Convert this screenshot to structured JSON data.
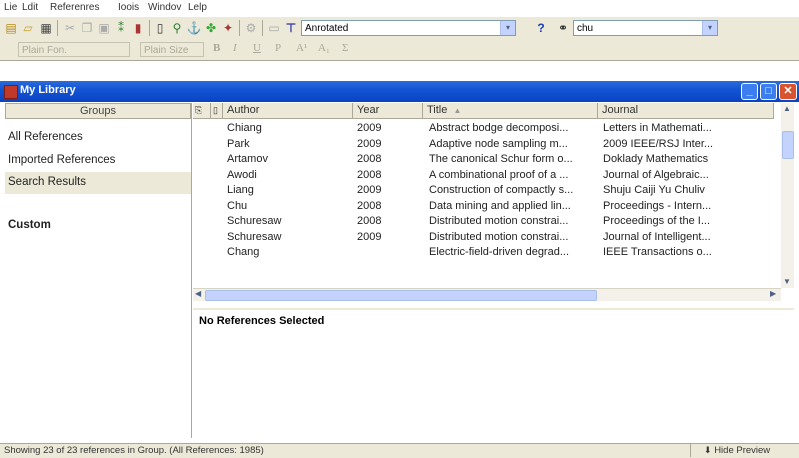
{
  "menu": [
    "Lie",
    "Ldit",
    "Referenres",
    "Ioois",
    "Windov",
    "Lelp"
  ],
  "toolbar": {
    "style_combo": "Anrotated",
    "help_label": "?",
    "search_combo": "chu"
  },
  "format_bar": {
    "font": "Plain Fon.",
    "size": "Plain Size",
    "bold": "B",
    "italic": "I",
    "underline": "U",
    "plain": "P",
    "superscript": "A¹",
    "subscript": "A₁",
    "symbol": "Σ"
  },
  "window": {
    "title": "My Library"
  },
  "groups": {
    "header": "Groups",
    "items": [
      "All References",
      "Imported References",
      "Search Results"
    ],
    "custom_label": "Custom"
  },
  "table": {
    "columns": [
      "Author",
      "Year",
      "Title",
      "Journal"
    ],
    "rows": [
      {
        "author": "Chiang",
        "year": "2009",
        "title": "Abstract bodge decomposi...",
        "journal": "Letters in Mathemati..."
      },
      {
        "author": "Park",
        "year": "2009",
        "title": "Adaptive node sampling m...",
        "journal": "2009 IEEE/RSJ Inter..."
      },
      {
        "author": "Artamov",
        "year": "2008",
        "title": "The canonical Schur form o...",
        "journal": "Doklady Mathematics"
      },
      {
        "author": "Awodi",
        "year": "2008",
        "title": "A combinational proof of a ...",
        "journal": "Journal of Algebraic..."
      },
      {
        "author": "Liang",
        "year": "2009",
        "title": "Construction of compactly s...",
        "journal": "Shuju Caiji Yu Chuliv"
      },
      {
        "author": "Chu",
        "year": "2008",
        "title": "Data mining and applied lin...",
        "journal": "Proceedings - Intern..."
      },
      {
        "author": "Schuresaw",
        "year": "2008",
        "title": "Distributed motion constrai...",
        "journal": "Proceedings of the I..."
      },
      {
        "author": "Schuresaw",
        "year": "2009",
        "title": "Distributed motion constrai...",
        "journal": "Journal of Intelligent..."
      },
      {
        "author": "Chang",
        "year": "",
        "title": "Electric-field-driven degrad...",
        "journal": "IEEE Transactions o..."
      }
    ]
  },
  "preview": {
    "text": "No References Selected"
  },
  "status": {
    "text": "Showing 23 of 23 references in Group. (All References: 1985)",
    "hide_preview": "Hide Preview"
  }
}
